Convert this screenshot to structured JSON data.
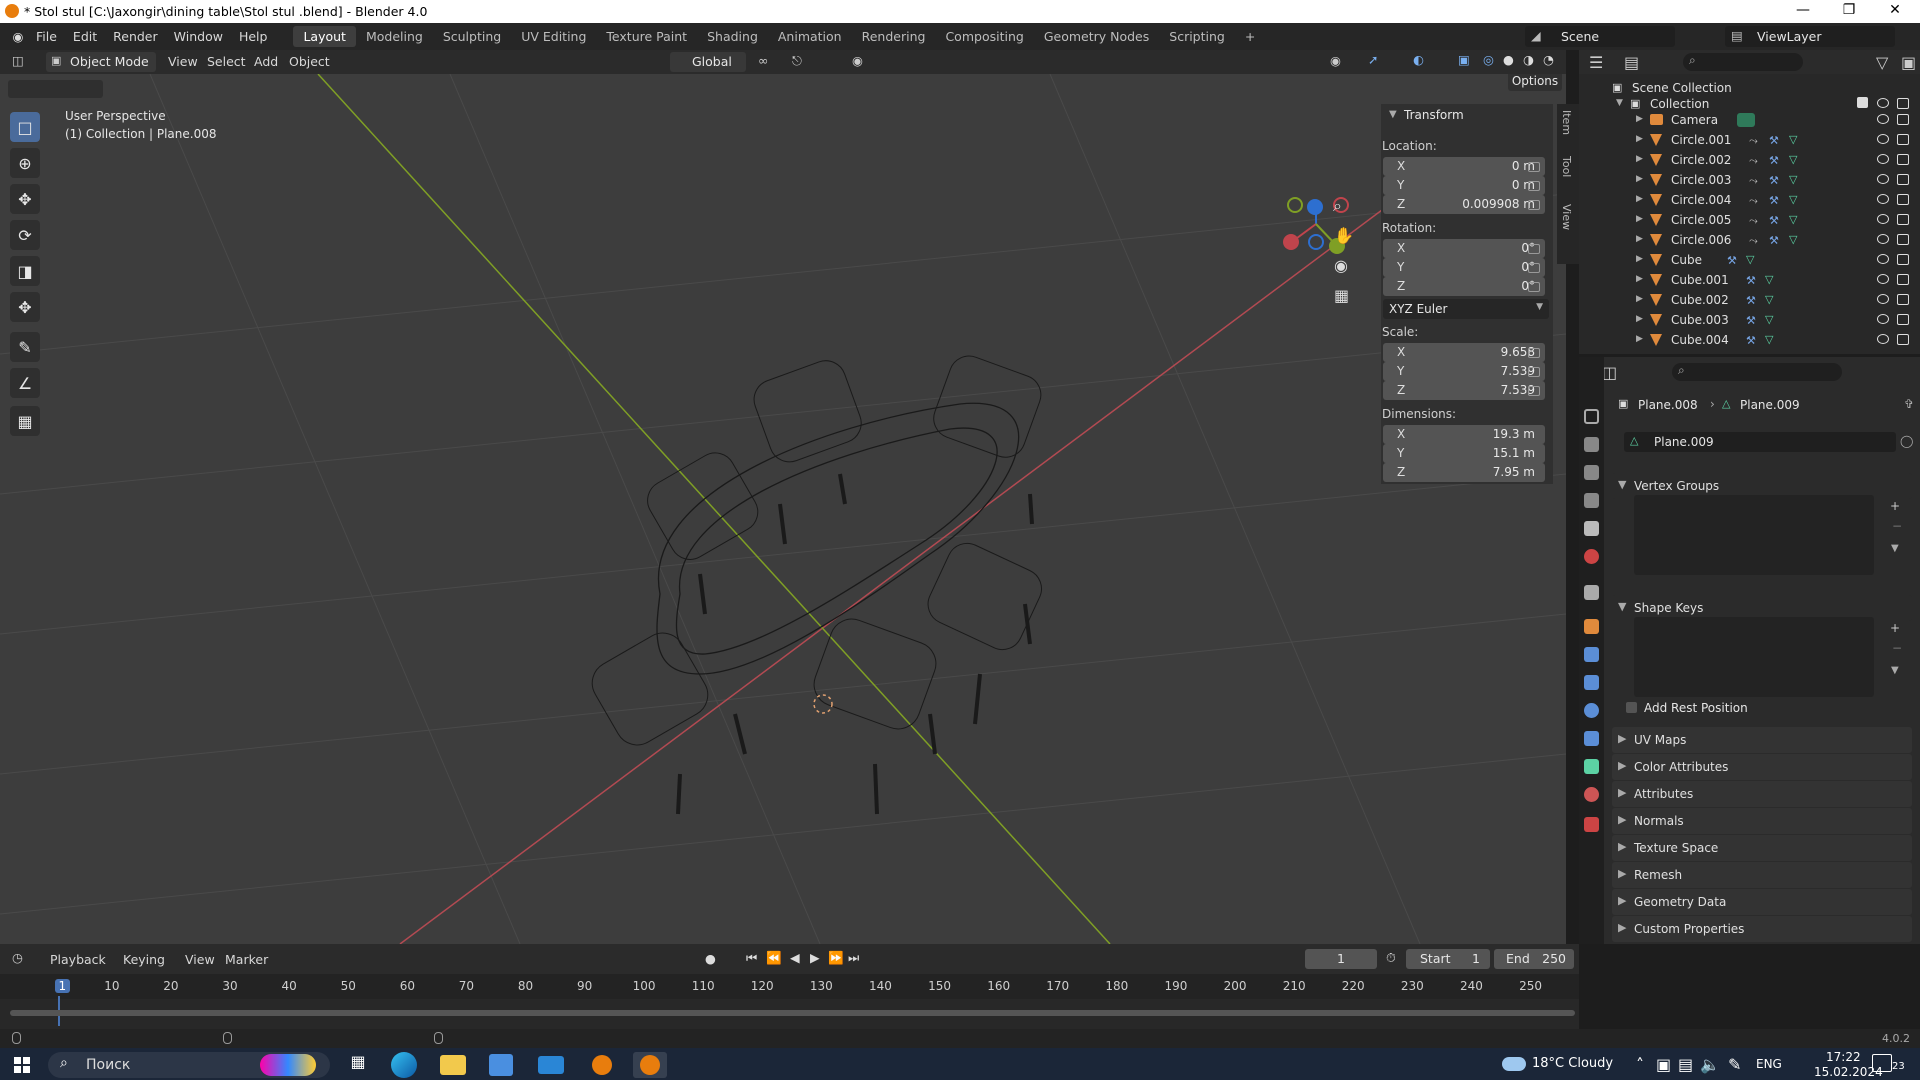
{
  "window": {
    "title": "* Stol stul  [C:\\Jaxongir\\dining table\\Stol stul .blend] - Blender 4.0"
  },
  "menu": {
    "items": [
      "File",
      "Edit",
      "Render",
      "Window",
      "Help"
    ]
  },
  "workspaces": [
    "Layout",
    "Modeling",
    "Sculpting",
    "UV Editing",
    "Texture Paint",
    "Shading",
    "Animation",
    "Rendering",
    "Compositing",
    "Geometry Nodes",
    "Scripting"
  ],
  "active_workspace": "Layout",
  "scene": {
    "label": "Scene",
    "viewlayer": "ViewLayer"
  },
  "viewport_header": {
    "mode": "Object Mode",
    "menus": [
      "View",
      "Select",
      "Add",
      "Object"
    ],
    "orientation": "Global",
    "options": "Options"
  },
  "viewport": {
    "perspective": "User Perspective",
    "collection": "(1) Collection | Plane.008"
  },
  "transform": {
    "title": "Transform",
    "location_label": "Location:",
    "location": [
      {
        "axis": "X",
        "value": "0 m"
      },
      {
        "axis": "Y",
        "value": "0 m"
      },
      {
        "axis": "Z",
        "value": "0.009908 m"
      }
    ],
    "rotation_label": "Rotation:",
    "rotation": [
      {
        "axis": "X",
        "value": "0°"
      },
      {
        "axis": "Y",
        "value": "0°"
      },
      {
        "axis": "Z",
        "value": "0°"
      }
    ],
    "rotation_mode": "XYZ Euler",
    "scale_label": "Scale:",
    "scale": [
      {
        "axis": "X",
        "value": "9.658"
      },
      {
        "axis": "Y",
        "value": "7.539"
      },
      {
        "axis": "Z",
        "value": "7.539"
      }
    ],
    "dimensions_label": "Dimensions:",
    "dimensions": [
      {
        "axis": "X",
        "value": "19.3 m"
      },
      {
        "axis": "Y",
        "value": "15.1 m"
      },
      {
        "axis": "Z",
        "value": "7.95 m"
      }
    ]
  },
  "sidebar_tabs": [
    "Item",
    "Tool",
    "View"
  ],
  "outliner": {
    "scene_collection": "Scene Collection",
    "collection": "Collection",
    "items": [
      "Camera",
      "Circle.001",
      "Circle.002",
      "Circle.003",
      "Circle.004",
      "Circle.005",
      "Circle.006",
      "Cube",
      "Cube.001",
      "Cube.002",
      "Cube.003",
      "Cube.004"
    ]
  },
  "properties": {
    "object": "Plane.008",
    "data": "Plane.009",
    "mesh_name": "Plane.009",
    "sections": {
      "vertex_groups": "Vertex Groups",
      "shape_keys": "Shape Keys",
      "add_rest": "Add Rest Position",
      "uv_maps": "UV Maps",
      "color_attributes": "Color Attributes",
      "attributes": "Attributes",
      "normals": "Normals",
      "texture_space": "Texture Space",
      "remesh": "Remesh",
      "geometry_data": "Geometry Data",
      "custom_properties": "Custom Properties"
    }
  },
  "timeline": {
    "menus": [
      "Playback",
      "Keying",
      "View",
      "Marker"
    ],
    "current_frame": "1",
    "start_label": "Start",
    "start": "1",
    "end_label": "End",
    "end": "250",
    "ticks": [
      "1",
      "10",
      "20",
      "30",
      "40",
      "50",
      "60",
      "70",
      "80",
      "90",
      "100",
      "110",
      "120",
      "130",
      "140",
      "150",
      "160",
      "170",
      "180",
      "190",
      "200",
      "210",
      "220",
      "230",
      "240",
      "250"
    ]
  },
  "status": {
    "version": "4.0.2"
  },
  "taskbar": {
    "search": "Поиск",
    "weather": "18°C  Cloudy",
    "lang": "ENG",
    "time": "17:22",
    "date": "15.02.2024",
    "notif": "23"
  }
}
